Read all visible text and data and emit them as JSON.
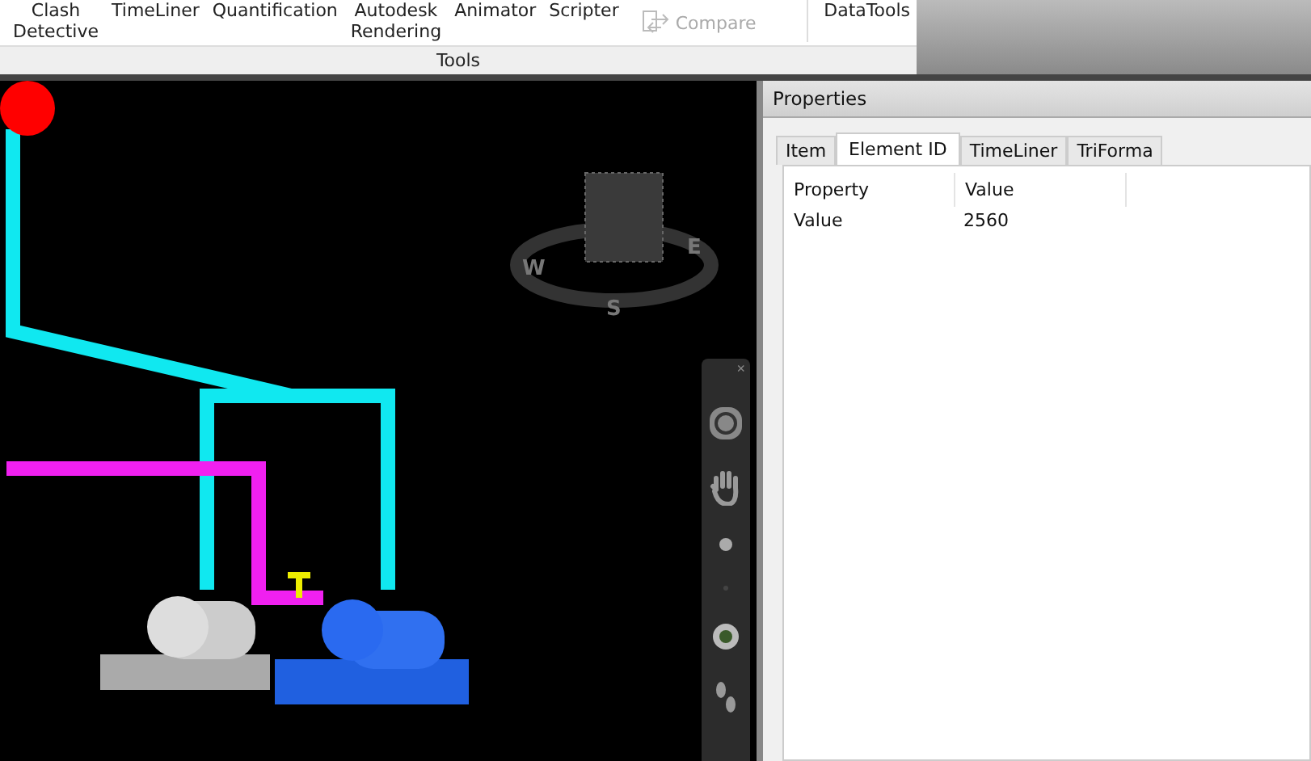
{
  "ribbon": {
    "tools": [
      {
        "lines": [
          "Clash",
          "Detective"
        ],
        "disabled": false
      },
      {
        "lines": [
          "TimeLiner"
        ],
        "disabled": false
      },
      {
        "lines": [
          "Quantification"
        ],
        "disabled": false
      },
      {
        "lines": [
          "Autodesk",
          "Rendering"
        ],
        "disabled": false
      },
      {
        "lines": [
          "Animator"
        ],
        "disabled": false
      },
      {
        "lines": [
          "Scripter"
        ],
        "disabled": false
      },
      {
        "lines": [
          "Compare"
        ],
        "disabled": true,
        "kind": "icon"
      },
      {
        "lines": [
          "DataTools"
        ],
        "disabled": false
      }
    ],
    "group_label": "Tools"
  },
  "viewport": {
    "compass": [
      "W",
      "E",
      "S"
    ],
    "nav_bar": {
      "close": "×"
    }
  },
  "properties": {
    "title": "Properties",
    "tabs": [
      {
        "label": "Item",
        "selected": false
      },
      {
        "label": "Element ID",
        "selected": true
      },
      {
        "label": "TimeLiner",
        "selected": false
      },
      {
        "label": "TriForma",
        "selected": false
      }
    ],
    "columns": [
      "Property",
      "Value"
    ],
    "rows": [
      [
        "Value",
        "2560"
      ]
    ]
  }
}
